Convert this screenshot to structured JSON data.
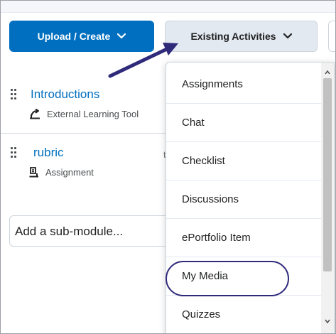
{
  "toolbar": {
    "upload_label": "Upload / Create",
    "existing_label": "Existing Activities"
  },
  "modules": [
    {
      "title": "Introductions",
      "type": "External Learning Tool",
      "type_icon": "external-tool-icon"
    },
    {
      "title": "rubric",
      "type": "Assignment",
      "type_icon": "assignment-icon"
    }
  ],
  "sub_module_placeholder": "Add a sub-module...",
  "dropdown": {
    "items": [
      "Assignments",
      "Chat",
      "Checklist",
      "Discussions",
      "ePortfolio Item",
      "My Media",
      "Quizzes"
    ],
    "highlighted": "My Media"
  },
  "colors": {
    "primary_button": "#006fbf",
    "secondary_button": "#e3e9f1",
    "link": "#006fbf",
    "annotation": "#2f2a7a"
  }
}
